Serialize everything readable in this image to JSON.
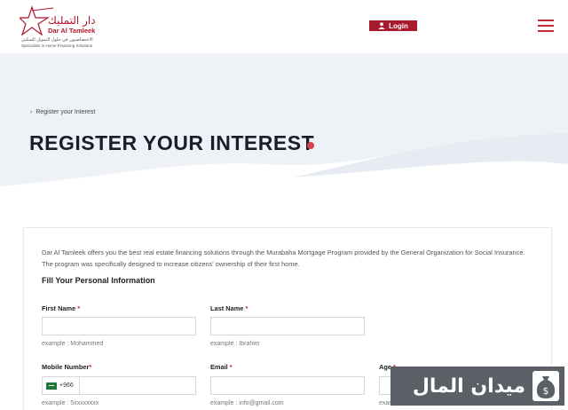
{
  "header": {
    "logo": {
      "arabic_name": "دار التمليك",
      "english_name": "Dar Al Tamleek",
      "tagline_ar": "الاختصاصيون في حلول التمويل السكني",
      "tagline_en": "Specialists in Home Financing Solutions"
    },
    "login_label": "Login",
    "icons": {
      "login": "user-icon",
      "menu": "hamburger-menu-icon"
    },
    "accent_color": "#a8192e"
  },
  "hero": {
    "breadcrumb": [
      "Register your Interest"
    ],
    "title": "REGISTER YOUR INTEREST",
    "dot_color": "#d9404f"
  },
  "form": {
    "intro": "Dar Al Tamleek offers you the best real estate financing solutions through the Murabaha Mortgage Program provided by the General Organization for Social Insurance. The program was specifically designed to increase citizens' ownership of their first home.",
    "section_title": "Fill Your Personal Information",
    "required_marker": "*",
    "fields": {
      "first_name": {
        "label": "First Name",
        "value": "",
        "hint": "example : Mohammed"
      },
      "last_name": {
        "label": "Last Name",
        "value": "",
        "hint": "example : Ibrahim"
      },
      "mobile": {
        "label": "Mobile Number",
        "prefix": "+966",
        "value": "",
        "hint": "example : 5xxxxxxxx"
      },
      "email": {
        "label": "Email",
        "value": "",
        "hint": "example : info@gmail.com"
      },
      "age": {
        "label": "Age",
        "value": "",
        "hint": "example : 30"
      }
    }
  },
  "watermark": {
    "text": "ميدان المال",
    "icon": "money-bag-icon"
  }
}
